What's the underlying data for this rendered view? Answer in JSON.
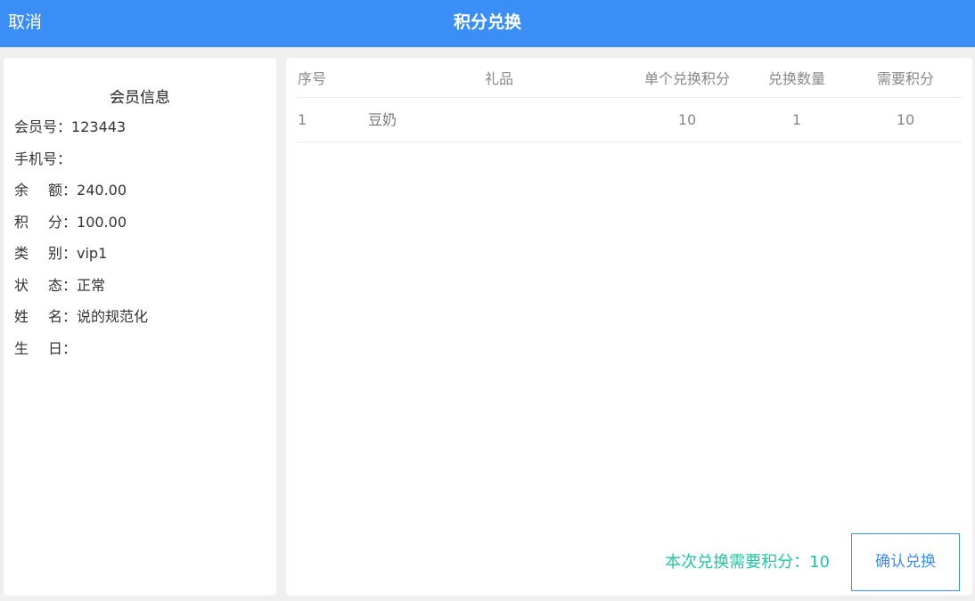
{
  "header": {
    "cancel_label": "取消",
    "title": "积分兑换"
  },
  "member": {
    "heading": "会员信息",
    "rows": [
      {
        "label": "会员号",
        "value": "123443"
      },
      {
        "label": "手机号",
        "value": ""
      },
      {
        "label": "余额",
        "value": "240.00"
      },
      {
        "label": "积分",
        "value": "100.00"
      },
      {
        "label": "类别",
        "value": "vip1"
      },
      {
        "label": "状态",
        "value": "正常"
      },
      {
        "label": "姓名",
        "value": "说的规范化"
      },
      {
        "label": "生日",
        "value": ""
      }
    ]
  },
  "table": {
    "columns": [
      "序号",
      "礼品",
      "单个兑换积分",
      "兑换数量",
      "需要积分"
    ],
    "rows": [
      {
        "index": "1",
        "gift": "豆奶",
        "unit_points": "10",
        "quantity": "1",
        "total_points": "10"
      }
    ]
  },
  "summary": {
    "label": "本次兑换需要积分：",
    "value": "10"
  },
  "confirm_label": "确认兑换",
  "colors": {
    "brand": "#3a8ef6",
    "total_text": "#23c4a4",
    "background": "#efefef"
  }
}
